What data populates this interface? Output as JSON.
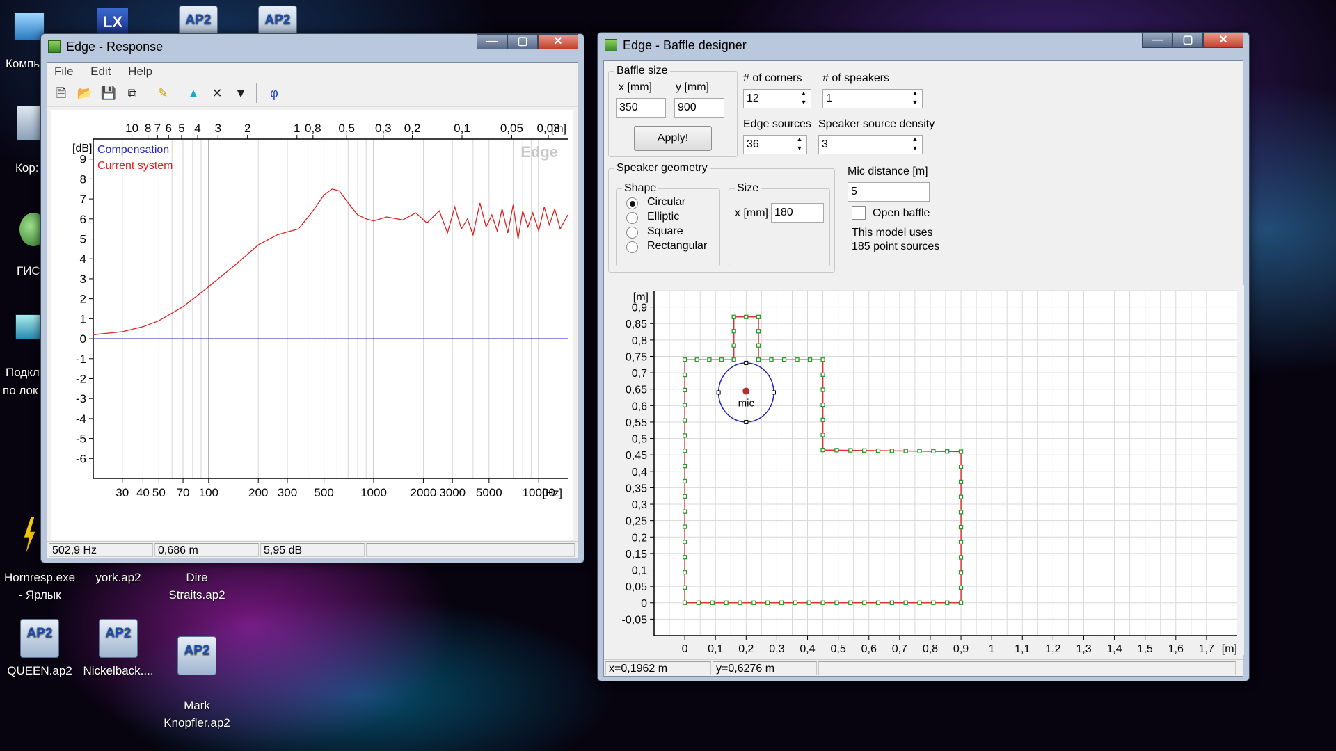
{
  "desktop": {
    "icons": [
      {
        "label": "QUEEN.ap2"
      },
      {
        "label": "Nickelback...."
      },
      {
        "label": "Mark\nKnopfler.ap2"
      },
      {
        "label": "Hornresp.exe\n- Ярлык"
      },
      {
        "label": "york.ap2"
      },
      {
        "label": "Dire\nStraits.ap2"
      }
    ],
    "partial_icons": [
      "Компь",
      "Кор:",
      "ГИС",
      "Подкл",
      "по лок"
    ],
    "ap2_badge": "AP2"
  },
  "response_window": {
    "title": "Edge - Response",
    "menu": [
      "File",
      "Edit",
      "Help"
    ],
    "toolbar_phi": "φ",
    "chart_data": {
      "type": "line",
      "xscale": "log",
      "xlim": [
        20,
        15000
      ],
      "ylim": [
        -7,
        10
      ],
      "xlabel": "[Hz]",
      "ylabel": "[dB]",
      "watermark": "Edge",
      "x_ticks": [
        30,
        40,
        50,
        70,
        100,
        200,
        300,
        500,
        1000,
        2000,
        3000,
        5000,
        10000
      ],
      "x_tick_labels": [
        "30",
        "40",
        "50",
        "70",
        "100",
        "200",
        "300",
        "500",
        "1000",
        "2000",
        "3000",
        "5000",
        "10000"
      ],
      "y_ticks": [
        9,
        8,
        7,
        6,
        5,
        4,
        3,
        2,
        1,
        0,
        -1,
        -2,
        -3,
        -4,
        -5,
        -6
      ],
      "top_axis_label": "[m]",
      "top_ticks": [
        {
          "label": "10",
          "freq": 34.3
        },
        {
          "label": "8",
          "freq": 42.9
        },
        {
          "label": "7",
          "freq": 49
        },
        {
          "label": "6",
          "freq": 57.2
        },
        {
          "label": "5",
          "freq": 68.6
        },
        {
          "label": "4",
          "freq": 85.8
        },
        {
          "label": "3",
          "freq": 114
        },
        {
          "label": "2",
          "freq": 172
        },
        {
          "label": "1",
          "freq": 343
        },
        {
          "label": "0,8",
          "freq": 429
        },
        {
          "label": "0,5",
          "freq": 686
        },
        {
          "label": "0,3",
          "freq": 1143
        },
        {
          "label": "0,2",
          "freq": 1715
        },
        {
          "label": "0,1",
          "freq": 3430
        },
        {
          "label": "0,05",
          "freq": 6860
        },
        {
          "label": "0,03",
          "freq": 11433
        }
      ],
      "series": [
        {
          "name": "Compensation",
          "color": "#1f1fd0",
          "x": [
            20,
            15000
          ],
          "y": [
            0,
            0
          ]
        },
        {
          "name": "Current system",
          "color": "#e02020",
          "x": [
            20,
            30,
            40,
            50,
            70,
            100,
            150,
            200,
            260,
            300,
            350,
            420,
            500,
            560,
            620,
            700,
            800,
            900,
            1000,
            1200,
            1500,
            1800,
            2100,
            2500,
            2800,
            3100,
            3400,
            3700,
            4000,
            4400,
            4800,
            5200,
            5600,
            6000,
            6500,
            7000,
            7500,
            8000,
            8600,
            9200,
            10000,
            10800,
            11600,
            12500,
            13500,
            15000
          ],
          "y": [
            0.2,
            0.35,
            0.6,
            0.9,
            1.6,
            2.6,
            3.8,
            4.7,
            5.2,
            5.35,
            5.5,
            6.3,
            7.2,
            7.5,
            7.4,
            6.8,
            6.2,
            6.0,
            5.9,
            6.1,
            5.95,
            6.3,
            5.8,
            6.4,
            5.3,
            6.6,
            5.5,
            6.0,
            5.2,
            6.8,
            5.6,
            6.2,
            5.4,
            6.5,
            5.3,
            6.7,
            5.0,
            6.4,
            5.6,
            6.3,
            5.4,
            6.6,
            5.7,
            6.5,
            5.5,
            6.2
          ]
        }
      ]
    },
    "status": {
      "freq": "502,9 Hz",
      "dist": "0,686 m",
      "level": "5,95 dB"
    }
  },
  "baffle_window": {
    "title": "Edge - Baffle designer",
    "baffle_size": {
      "label": "Baffle size",
      "x_label": "x [mm]",
      "y_label": "y [mm]",
      "x_value": "350",
      "y_value": "900",
      "apply": "Apply!"
    },
    "corners": {
      "label": "# of corners",
      "value": "12"
    },
    "speakers": {
      "label": "# of speakers",
      "value": "1"
    },
    "edge_sources": {
      "label": "Edge sources",
      "value": "36"
    },
    "speaker_density": {
      "label": "Speaker source density",
      "value": "3"
    },
    "geometry": {
      "label": "Speaker geometry",
      "shape_label": "Shape",
      "shapes": [
        "Circular",
        "Elliptic",
        "Square",
        "Rectangular"
      ],
      "selected": "Circular",
      "size_label": "Size",
      "size_x_label": "x [mm]",
      "size_x_value": "180"
    },
    "mic_distance": {
      "label": "Mic distance [m]",
      "value": "5"
    },
    "open_baffle": {
      "label": "Open baffle",
      "checked": false
    },
    "model_info": [
      "This model uses",
      "185 point sources"
    ],
    "plot": {
      "unit_label": "[m]",
      "mic_label": "mic",
      "x_ticks": [
        "0",
        "0,1",
        "0,2",
        "0,3",
        "0,4",
        "0,5",
        "0,6",
        "0,7",
        "0,8",
        "0,9",
        "1",
        "1,1",
        "1,2",
        "1,3",
        "1,4",
        "1,5",
        "1,6",
        "1,7"
      ],
      "y_ticks": [
        "0,9",
        "0,85",
        "0,8",
        "0,75",
        "0,7",
        "0,65",
        "0,6",
        "0,55",
        "0,5",
        "0,45",
        "0,4",
        "0,35",
        "0,3",
        "0,25",
        "0,2",
        "0,15",
        "0,1",
        "0,05",
        "0",
        "-0,05"
      ],
      "xlim": [
        -0.1,
        1.8
      ],
      "ylim": [
        -0.1,
        0.95
      ],
      "polygon": [
        [
          0,
          0
        ],
        [
          0.9,
          0
        ],
        [
          0.9,
          0.46
        ],
        [
          0.45,
          0.465
        ],
        [
          0.45,
          0.74
        ],
        [
          0.24,
          0.74
        ],
        [
          0.24,
          0.87
        ],
        [
          0.16,
          0.87
        ],
        [
          0.16,
          0.74
        ],
        [
          0,
          0.74
        ]
      ],
      "speaker": {
        "cx": 0.2,
        "cy": 0.64,
        "r": 0.09
      },
      "outline_colors": {
        "edge": "#2a9a2a",
        "line": "#e03030",
        "speaker": "#2020c0"
      }
    },
    "status": {
      "x": "x=0,1962 m",
      "y": "y=0,6276 m"
    }
  }
}
